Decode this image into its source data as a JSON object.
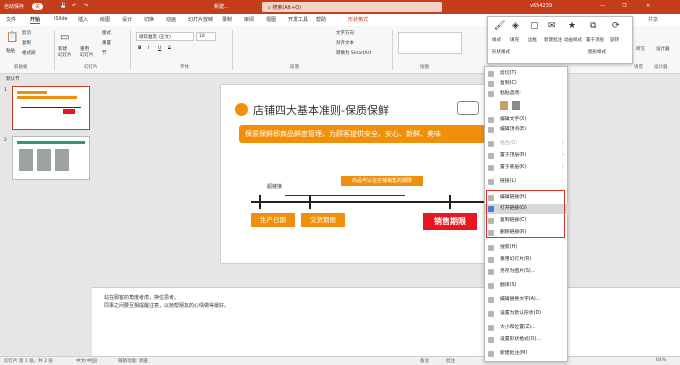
{
  "titlebar": {
    "autosave": "自动保存",
    "autosave_state": "关",
    "doc_title": "新建...",
    "search_placeholder": "搜索(Alt+Q)",
    "user": "v654239",
    "right_tab": "形状格式"
  },
  "tabs": [
    {
      "label": "文件"
    },
    {
      "label": "开始"
    },
    {
      "label": "iSlide"
    },
    {
      "label": "插入"
    },
    {
      "label": "绘图"
    },
    {
      "label": "设计"
    },
    {
      "label": "切换"
    },
    {
      "label": "动画"
    },
    {
      "label": "幻灯片放映"
    },
    {
      "label": "录制"
    },
    {
      "label": "审阅"
    },
    {
      "label": "视图"
    },
    {
      "label": "开发工具"
    },
    {
      "label": "帮助"
    }
  ],
  "share_label": "共享",
  "ribbon": {
    "paste": "粘贴",
    "cut": "剪切",
    "copy": "复制",
    "format_painter": "格式刷",
    "new_slide": "新建\n幻灯片",
    "reuse": "重用\n幻灯片",
    "layout": "版式",
    "reset": "重置",
    "section": "节",
    "font_name": "微软雅黑 (正文)",
    "font_size": "18",
    "bold": "B",
    "italic": "I",
    "underline": "U",
    "strike": "S",
    "text_direction": "文字方向",
    "align_text": "对齐文本",
    "smartart": "转换为 SmartArt",
    "find": "查找",
    "replace": "替换",
    "select": "选择",
    "voice": "听写",
    "design_ideas": "设计器",
    "groups": {
      "clipboard": "剪贴板",
      "slides": "幻灯片",
      "font": "字体",
      "paragraph": "段落",
      "drawing": "绘图",
      "voice": "语音",
      "designer": "设计器"
    }
  },
  "mini_toolbar": {
    "style": "样式",
    "fill": "填充",
    "outline": "边框",
    "new_comment": "新建批注",
    "animation": "动画样式",
    "bring_front": "置于顶层",
    "rotate": "旋转",
    "crop": "图形样式",
    "shape_format": "形状格式"
  },
  "sections": {
    "default": "默认节"
  },
  "slide": {
    "title": "店铺四大基本准则-保质保鲜",
    "banner": "保质保鲜即商品鲜度管理，为顾客提供安全、安心、新鲜、美味",
    "hint": "商品可以在店铺销售的期限",
    "hyperlink": "超链接",
    "box1": "生产日期",
    "box2": "交货期限",
    "box3": "销售期限"
  },
  "thumbnails": [
    {
      "num": "1"
    },
    {
      "num": "2"
    }
  ],
  "notes": {
    "line1": "站在顾客的角度考虑，换位思考。",
    "line2": "同事之间要互相提醒注意，以她帮朋友的心情做得最好。"
  },
  "status": {
    "slide_info": "幻灯片 第 1 张，共 2 张",
    "language": "中文(中国)",
    "accessibility": "辅助功能: 调查",
    "notes": "备注",
    "comments": "批注",
    "zoom": "64%"
  },
  "context_menu": {
    "items": [
      {
        "label": "剪切(T)",
        "icon": "scissors-icon"
      },
      {
        "label": "复制(C)",
        "icon": "copy-icon"
      },
      {
        "label": "粘贴选项:",
        "icon": "paste-icon"
      },
      {
        "label": "",
        "icon": "paste-options-icon"
      },
      {
        "label": "编辑文字(X)",
        "icon": "edit-text-icon"
      },
      {
        "label": "编辑顶点(E)",
        "icon": "edit-points-icon"
      },
      {
        "label": "组合(G)",
        "icon": "group-icon",
        "submenu": true,
        "disabled": true
      },
      {
        "label": "置于顶层(R)",
        "icon": "bring-front-icon",
        "submenu": true
      },
      {
        "label": "置于底层(K)",
        "icon": "send-back-icon",
        "submenu": true
      },
      {
        "label": "链接(L)",
        "icon": "link-icon"
      },
      {
        "label": "编辑链接(H)",
        "icon": "edit-link-icon"
      },
      {
        "label": "打开链接(O)",
        "icon": "open-link-icon",
        "highlighted": true
      },
      {
        "label": "复制链接(C)",
        "icon": "copy-link-icon"
      },
      {
        "label": "删除链接(R)",
        "icon": "remove-link-icon"
      },
      {
        "label": "搜索(H)",
        "icon": "search-icon"
      },
      {
        "label": "重用幻灯片(R)",
        "icon": "reuse-icon"
      },
      {
        "label": "另存为图片(S)...",
        "icon": "save-image-icon"
      },
      {
        "label": "翻译(S)",
        "icon": "translate-icon"
      },
      {
        "label": "编辑替换文字(A)...",
        "icon": "alt-text-icon"
      },
      {
        "label": "设置为默认形状(D)",
        "icon": "default-shape-icon"
      },
      {
        "label": "大小和位置(Z)...",
        "icon": "size-icon"
      },
      {
        "label": "设置形状格式(O)...",
        "icon": "format-shape-icon"
      },
      {
        "label": "新建批注(M)",
        "icon": "comment-icon"
      }
    ]
  },
  "colors": {
    "accent": "#c43e1c",
    "orange": "#f0900a",
    "red": "#e8171f",
    "highlight_box": "#e0322a"
  }
}
